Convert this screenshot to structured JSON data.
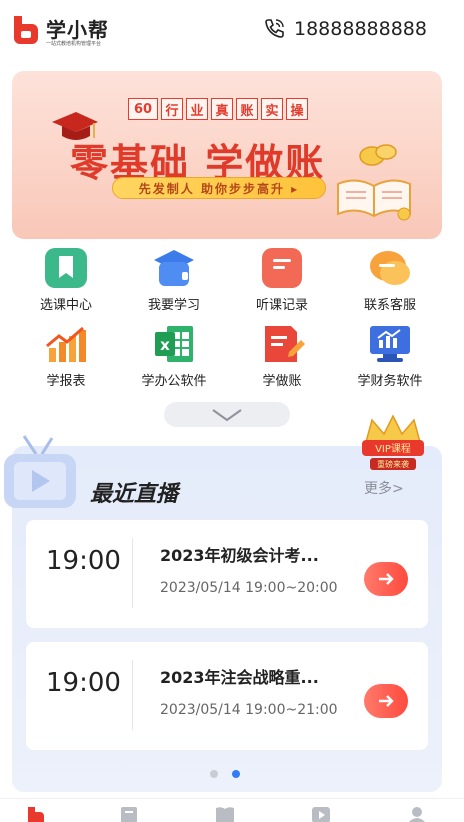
{
  "header": {
    "app_name": "学小帮",
    "app_subtitle": "一站式教培机构管理平台",
    "phone": "18888888888"
  },
  "banner": {
    "tags": [
      "60",
      "行",
      "业",
      "真",
      "账",
      "实",
      "操"
    ],
    "title": "零基础 学做账",
    "cta": "先发制人 助你步步高升 ▸"
  },
  "grid": [
    {
      "label": "选课中心",
      "icon": "bookmark-icon",
      "color": "#3cb98a"
    },
    {
      "label": "我要学习",
      "icon": "graduation-cap-icon",
      "color": "#3b7bea"
    },
    {
      "label": "听课记录",
      "icon": "record-book-icon",
      "color": "#f26a55"
    },
    {
      "label": "联系客服",
      "icon": "chat-bubble-icon",
      "color": "#f7a23a"
    },
    {
      "label": "学报表",
      "icon": "bar-chart-icon",
      "color": "#f28a2a"
    },
    {
      "label": "学办公软件",
      "icon": "excel-icon",
      "color": "#1f9d55"
    },
    {
      "label": "学做账",
      "icon": "pen-document-icon",
      "color": "#e8473a"
    },
    {
      "label": "学财务软件",
      "icon": "monitor-chart-icon",
      "color": "#3d6fe0"
    }
  ],
  "live": {
    "title": "最近直播",
    "more": "更多>",
    "vip_line1": "VIP课程",
    "vip_line2": "重磅来袭",
    "cards": [
      {
        "time": "19:00",
        "title": "2023年初级会计考...",
        "date": "2023/05/14 19:00~20:00"
      },
      {
        "time": "19:00",
        "title": "2023年注会战略重...",
        "date": "2023/05/14 19:00~21:00"
      }
    ]
  },
  "colors": {
    "accent": "#ff4a3e",
    "dot_active": "#2f7cf6"
  }
}
